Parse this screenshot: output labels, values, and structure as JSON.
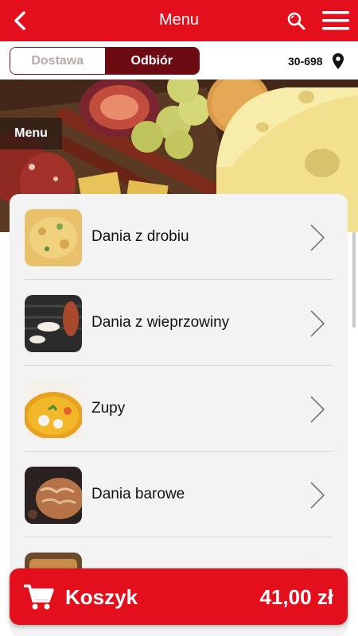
{
  "header": {
    "title": "Menu",
    "back_icon": "chevron-left-icon",
    "search_icon": "search-icon",
    "menu_icon": "hamburger-icon"
  },
  "delivery_toggle": {
    "options": [
      "Dostawa",
      "Odbiór"
    ],
    "selected": "Odbiór"
  },
  "location": {
    "postcode": "30-698",
    "icon": "location-pin-icon"
  },
  "hero": {
    "tag": "Menu"
  },
  "categories": [
    {
      "label": "Dania z drobiu",
      "icon": "chevron-right-icon"
    },
    {
      "label": "Dania z wieprzowiny",
      "icon": "chevron-right-icon"
    },
    {
      "label": "Zupy",
      "icon": "chevron-right-icon"
    },
    {
      "label": "Dania barowe",
      "icon": "chevron-right-icon"
    },
    {
      "label": "",
      "icon": "chevron-right-icon"
    }
  ],
  "cart": {
    "label": "Koszyk",
    "total": "41,00 zł",
    "icon": "shopping-cart-icon"
  },
  "colors": {
    "brand_red": "#e30f1c",
    "dark_red": "#6d0b12",
    "card_bg": "#f3f3f3"
  }
}
